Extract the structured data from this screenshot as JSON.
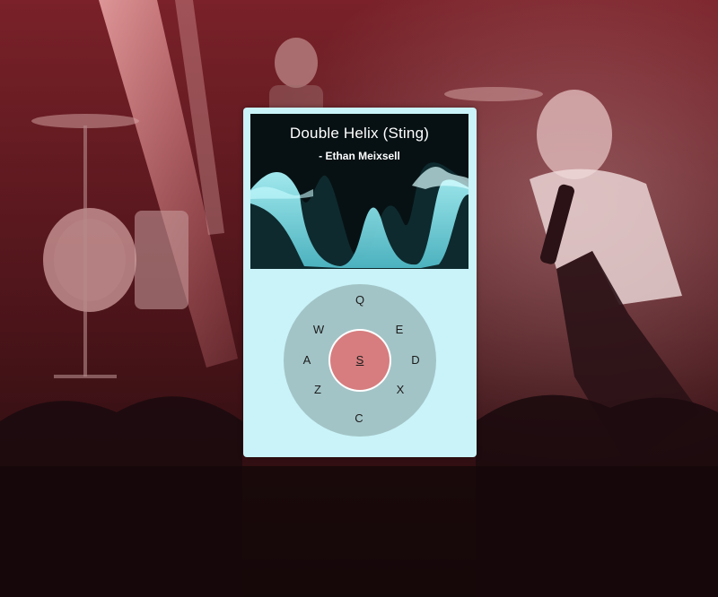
{
  "player": {
    "title": "Double Helix (Sting)",
    "artist": "- Ethan Meixsell",
    "center_key": "S",
    "keys": {
      "q": "Q",
      "e": "E",
      "d": "D",
      "x": "X",
      "c": "C",
      "z": "Z",
      "a": "A",
      "w": "W"
    }
  },
  "colors": {
    "player_body": "#c9f3f8",
    "screen_bg": "#071113",
    "wave": "#7fe0ea",
    "wheel": "#a3c4c7",
    "center_button": "#d77d7f",
    "background_tint": "#7a2129"
  },
  "icons": {
    "background": "concert-photo"
  }
}
